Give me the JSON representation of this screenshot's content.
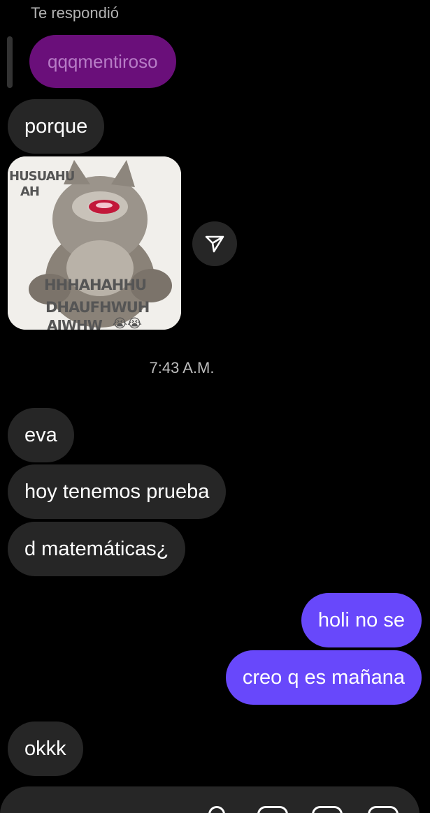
{
  "reply": {
    "caption": "Te respondió",
    "quoted_text": "qqqmentiroso"
  },
  "messages_top": [
    {
      "text": "porque",
      "direction": "in"
    }
  ],
  "sticker": {
    "lines": [
      "HUSUAHU",
      "AH",
      "HHHAHAHHU",
      "DHAUFHWUH",
      "AJWHW"
    ],
    "emoji": "😭😭"
  },
  "timestamp": "7:43 A.M.",
  "messages": [
    {
      "text": "eva",
      "direction": "in"
    },
    {
      "text": "hoy tenemos prueba",
      "direction": "in"
    },
    {
      "text": "d matemáticas¿",
      "direction": "in"
    },
    {
      "text": "holi no se",
      "direction": "out"
    },
    {
      "text": "creo q es mañana",
      "direction": "out"
    },
    {
      "text": "okkk",
      "direction": "in"
    }
  ],
  "colors": {
    "incoming_bubble": "#262626",
    "outgoing_bubble": "#6848fb",
    "reply_quote": "#6a0f7a",
    "background": "#000000"
  }
}
